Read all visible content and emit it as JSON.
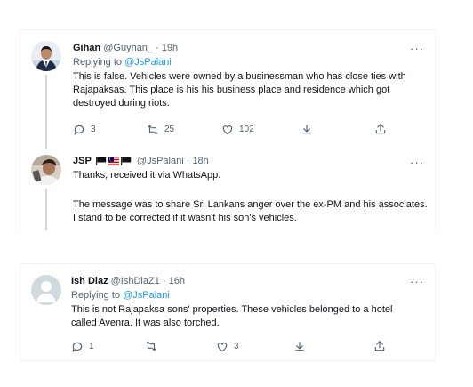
{
  "tweets": [
    {
      "name": "Gihan",
      "meta": "@Guyhan_ · 19h",
      "reply_prefix": "Replying to ",
      "reply_handle": "@JsPalani",
      "text": "This is false. Vehicles were owned by a businessman who has close ties with Rajapaksas. This place is his his business place and residence which got destroyed during riots.",
      "replies": "3",
      "retweets": "25",
      "likes": "102"
    },
    {
      "name": "JSP",
      "meta": "@JsPalani · 18h",
      "text1": "Thanks, received it via WhatsApp.",
      "text2": "The message was to share Sri Lankans anger over the ex-PM and his associates. I stand to be corrected if it wasn't his son's vehicles."
    },
    {
      "name": "Ish Diaz",
      "meta": "@IshDiaZ1 · 16h",
      "reply_prefix": "Replying to ",
      "reply_handle": "@JsPalani",
      "text": "This is not Rajapaksa sons' properties. These vehicles belonged to a hotel called Avenra. It was also torched.",
      "replies": "1",
      "likes": "3"
    }
  ],
  "more_label": "···",
  "colors": {
    "accent": "#1d9bf0",
    "muted": "#536471",
    "text": "#0f1419",
    "line": "#cfd9de"
  }
}
